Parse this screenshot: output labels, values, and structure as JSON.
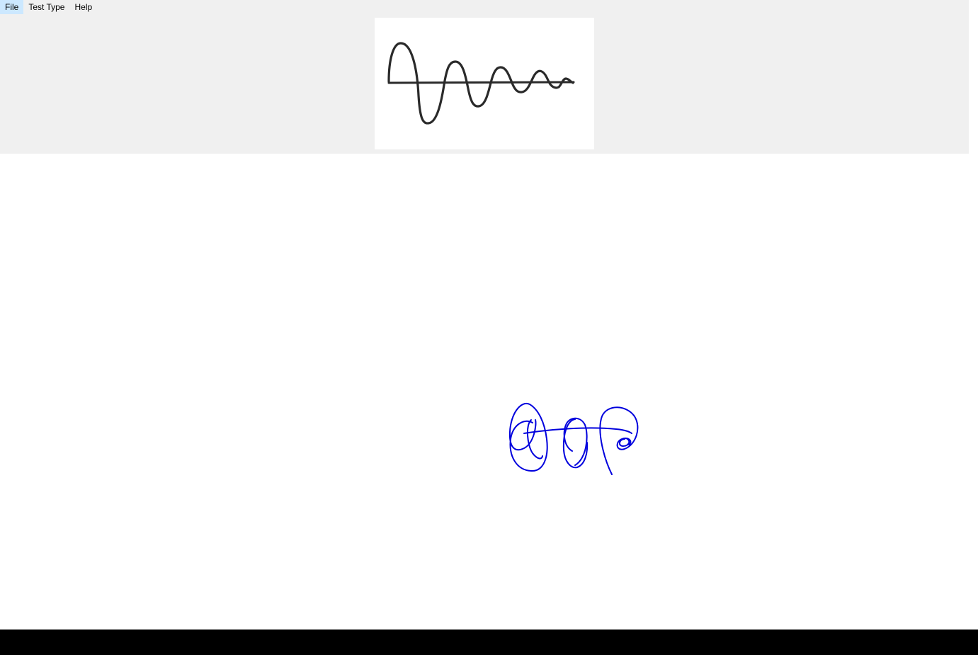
{
  "menu": {
    "items": [
      {
        "label": "File"
      },
      {
        "label": "Test Type"
      },
      {
        "label": "Help"
      }
    ]
  },
  "reference": {
    "description_icon": "damped-sine-wave-icon",
    "stroke_color": "#2a2a2a"
  },
  "canvas": {
    "ink_color": "#0000dd",
    "background": "#ffffff"
  },
  "colors": {
    "panel_background": "#f0f0f0",
    "outer_background": "#000000"
  }
}
